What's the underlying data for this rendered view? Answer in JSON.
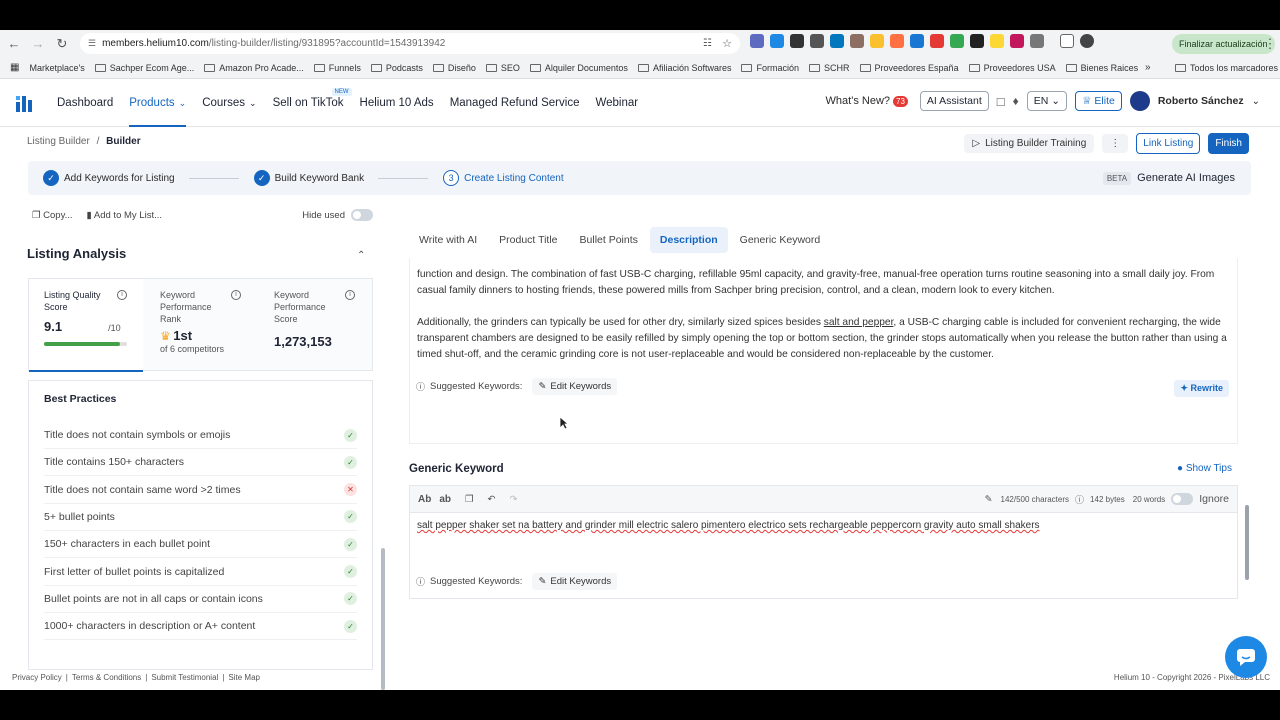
{
  "browser": {
    "host": "members.helium10.com",
    "path": "/listing-builder/listing/931895?accountId=1543913942",
    "update_label": "Finalizar actualización",
    "bookmarks": [
      "Marketplace's",
      "Sachper Ecom Age...",
      "Amazon Pro Acade...",
      "Funnels",
      "Podcasts",
      "Diseño",
      "SEO",
      "Alquiler Documentos",
      "Afiliación Softwares",
      "Formación",
      "SCHR",
      "Proveedores España",
      "Proveedores USA",
      "Bienes Raices"
    ],
    "all_bookmarks": "Todos los marcadores"
  },
  "nav": {
    "items": [
      "Dashboard",
      "Products",
      "Courses",
      "Sell on TikTok",
      "Helium 10 Ads",
      "Managed Refund Service",
      "Webinar"
    ],
    "new_tag": "NEW",
    "whats_new": "What's New?",
    "whats_new_count": "73",
    "ai_assistant": "AI Assistant",
    "lang": "EN",
    "elite": "Elite",
    "user": "Roberto Sánchez"
  },
  "builder": {
    "crumb_root": "Listing Builder",
    "crumb_sep": "/",
    "crumb_current": "Builder",
    "training": "Listing Builder Training",
    "link_listing": "Link Listing",
    "finish": "Finish",
    "steps": [
      "Add Keywords for Listing",
      "Build Keyword Bank",
      "Create Listing Content"
    ],
    "step3_num": "3",
    "beta": "BETA",
    "gen_ai": "Generate AI Images"
  },
  "left": {
    "copy": "Copy...",
    "add_list": "Add to My List...",
    "hide_used": "Hide used",
    "analysis_title": "Listing Analysis",
    "quality_label": "Listing Quality Score",
    "quality_value": "9.1",
    "quality_max": "/10",
    "quality_fraction": 0.91,
    "kpr_label": "Keyword Performance Rank",
    "kpr_value": "1st",
    "kpr_sub": "of 6 competitors",
    "kps_label": "Keyword Performance Score",
    "kps_value": "1,273,153",
    "bp_title": "Best Practices",
    "practices": [
      {
        "text": "Title does not contain symbols or emojis",
        "ok": true
      },
      {
        "text": "Title contains 150+ characters",
        "ok": true
      },
      {
        "text": "Title does not contain same word >2 times",
        "ok": false
      },
      {
        "text": "5+ bullet points",
        "ok": true
      },
      {
        "text": "150+ characters in each bullet point",
        "ok": true
      },
      {
        "text": "First letter of bullet points is capitalized",
        "ok": true
      },
      {
        "text": "Bullet points are not in all caps or contain icons",
        "ok": true
      },
      {
        "text": "1000+ characters in description or A+ content",
        "ok": true
      }
    ]
  },
  "tabs": [
    "Write with AI",
    "Product Title",
    "Bullet Points",
    "Description",
    "Generic Keyword"
  ],
  "desc": {
    "p1": "function and design. The combination of fast USB-C charging, refillable 95ml capacity, and gravity-free, manual-free operation turns routine seasoning into a small daily joy. From casual family dinners to hosting friends, these powered mills from Sachper bring precision, control, and a clean, modern look to every kitchen.",
    "p2a": "Additionally, the grinders can typically be used for other dry, similarly sized spices besides ",
    "p2u": "salt and pepper",
    "p2b": ", a USB-C charging cable is included for convenient recharging, the wide transparent chambers are designed to be easily refilled by simply opening the top or bottom section, the grinder stops automatically when you release the button rather than using a timed shut-off, and the ceramic grinding core is not user-replaceable and would be considered non-replaceable by the customer.",
    "suggested": "Suggested Keywords:",
    "edit": "Edit Keywords",
    "rewrite": "Rewrite"
  },
  "generic": {
    "title": "Generic Keyword",
    "show_tips": "Show Tips",
    "chars": "142/500 characters",
    "bytes": "142 bytes",
    "words": "20 words",
    "ignore": "Ignore",
    "text": "salt pepper shaker set na battery and grinder mill electric salero pimentero electrico sets rechargeable peppercorn gravity auto small shakers",
    "suggested": "Suggested Keywords:",
    "edit": "Edit Keywords",
    "ab1": "Ab",
    "ab2": "ab"
  },
  "footer": {
    "privacy": "Privacy Policy",
    "terms": "Terms & Conditions",
    "submit": "Submit Testimonial",
    "sitemap": "Site Map",
    "copyright": "Helium 10 - Copyright 2026 - PixelLabs LLC"
  }
}
